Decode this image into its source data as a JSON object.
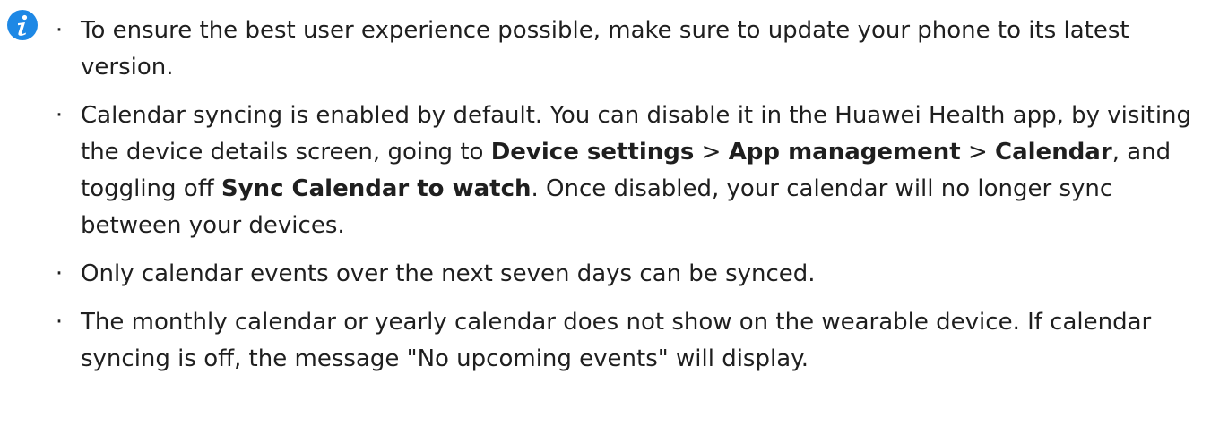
{
  "icon": "info-icon",
  "accent_color": "#1e88e5",
  "bullet_char": "·",
  "notes": [
    {
      "text": "To ensure the best user experience possible, make sure to update your phone to its latest version."
    },
    {
      "part1": "Calendar syncing is enabled by default. You can disable it in the Huawei Health app, by visiting the device details screen, going to ",
      "b1": "Device settings",
      "sep1": " > ",
      "b2": "App management",
      "sep2": " > ",
      "b3": "Calendar",
      "part2": ", and toggling off ",
      "b4": "Sync Calendar to watch",
      "part3": ". Once disabled, your calendar will no longer sync between your devices."
    },
    {
      "text": "Only calendar events over the next seven days can be synced."
    },
    {
      "text": "The monthly calendar or yearly calendar does not show on the wearable device. If calendar syncing is off, the message \"No upcoming events\" will display."
    }
  ]
}
